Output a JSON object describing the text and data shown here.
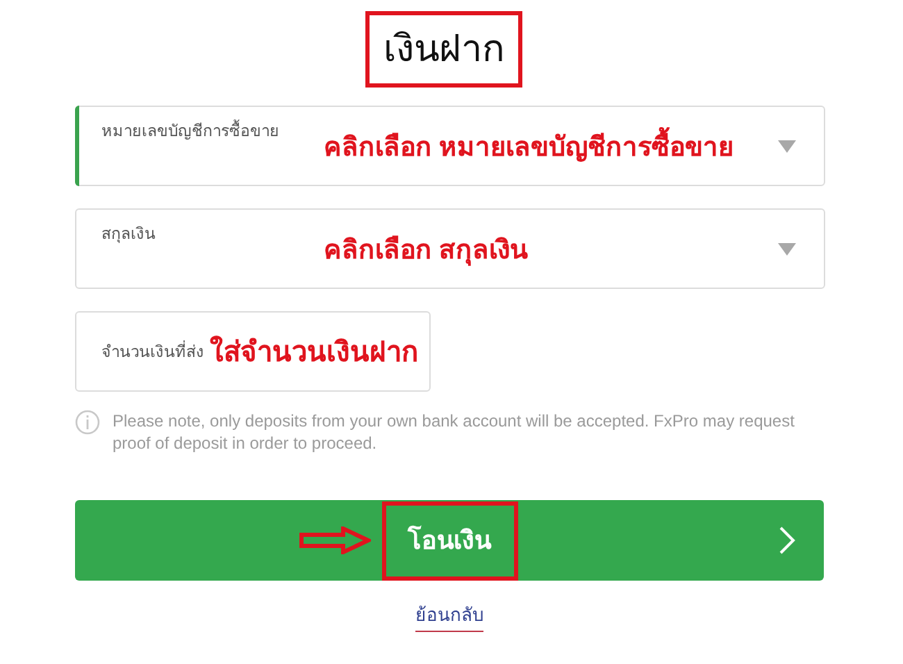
{
  "title": "เงินฝาก",
  "fields": [
    {
      "kind": "select",
      "label": "หมายเลขบัญชีการซื้อขาย",
      "annotation": "คลิกเลือก หมายเลขบัญชีการซื้อขาย",
      "focused": true
    },
    {
      "kind": "select",
      "label": "สกุลเงิน",
      "annotation": "คลิกเลือก สกุลเงิน",
      "focused": false
    },
    {
      "kind": "input",
      "label": "จำนวนเงินที่ส่ง",
      "annotation": "ใส่จำนวนเงินฝาก",
      "focused": false
    }
  ],
  "note": "Please note, only deposits from your own bank account will be accepted. FxPro may request proof of deposit in order to proceed.",
  "button": {
    "label": "โอนเงิน"
  },
  "back_link": "ย้อนกลับ"
}
